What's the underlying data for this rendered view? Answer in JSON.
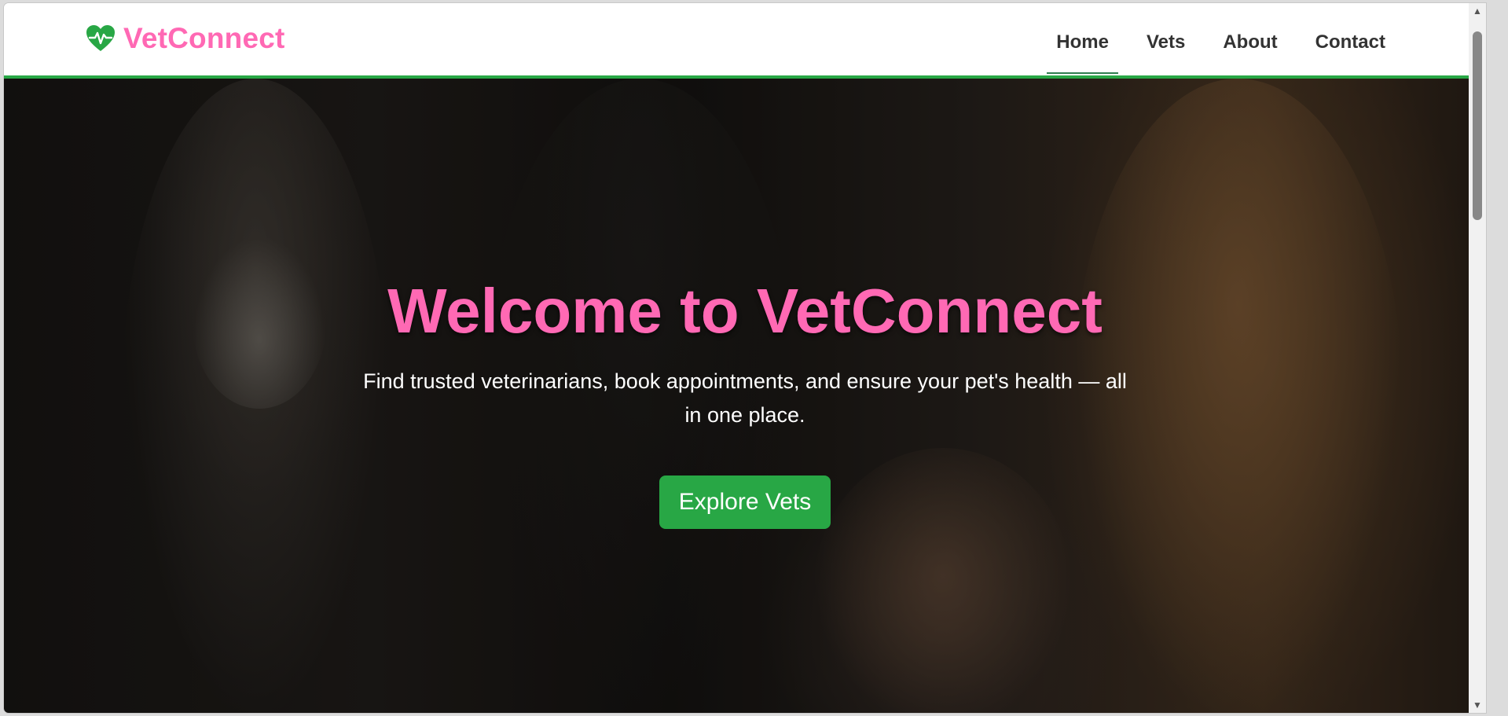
{
  "brand": {
    "name": "VetConnect",
    "icon": "heart-pulse-icon",
    "color": "#ff69b4",
    "icon_color": "#28a745"
  },
  "nav": {
    "items": [
      {
        "label": "Home",
        "active": true
      },
      {
        "label": "Vets",
        "active": false
      },
      {
        "label": "About",
        "active": false
      },
      {
        "label": "Contact",
        "active": false
      }
    ]
  },
  "hero": {
    "title": "Welcome to VetConnect",
    "subtitle": "Find trusted veterinarians, book appointments, and ensure your pet's health — all in one place.",
    "cta_label": "Explore Vets",
    "background_image": "kittens-photo"
  },
  "colors": {
    "accent": "#28a745",
    "title": "#ff69b4"
  }
}
